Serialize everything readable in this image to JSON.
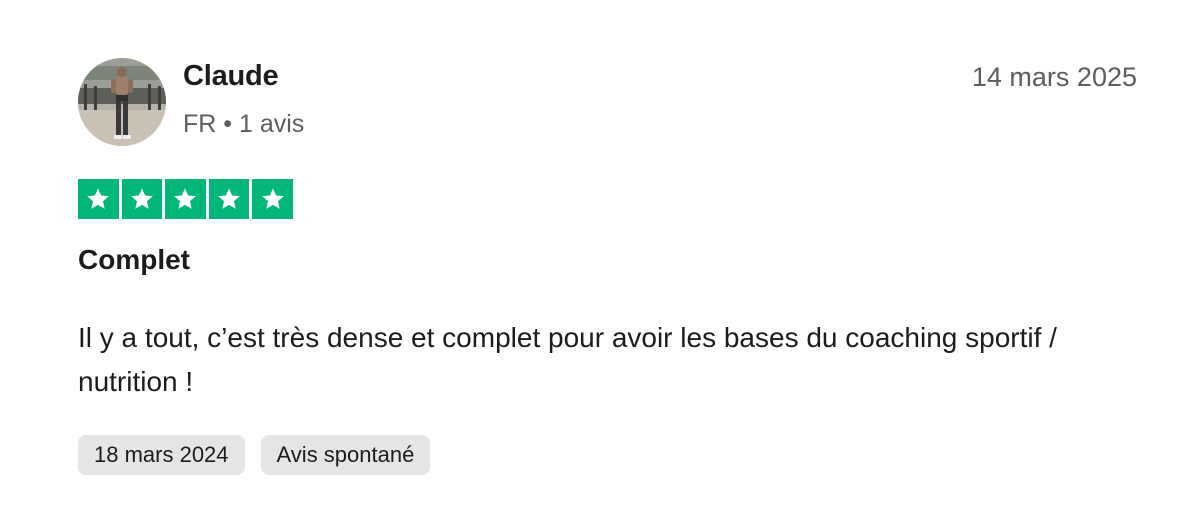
{
  "reviewer": {
    "name": "Claude",
    "country": "FR",
    "separator": "•",
    "review_count": "1 avis"
  },
  "review": {
    "date": "14 mars 2025",
    "rating": 5,
    "rating_max": 5,
    "star_color": "#00b67a",
    "title": "Complet",
    "body": "Il y a tout, c’est très dense et complet pour avoir les bases du coaching sportif / nutrition !"
  },
  "tags": [
    {
      "label": "18 mars 2024"
    },
    {
      "label": "Avis spontané"
    }
  ],
  "icons": {
    "avatar": "avatar-photo",
    "star": "star-icon"
  }
}
